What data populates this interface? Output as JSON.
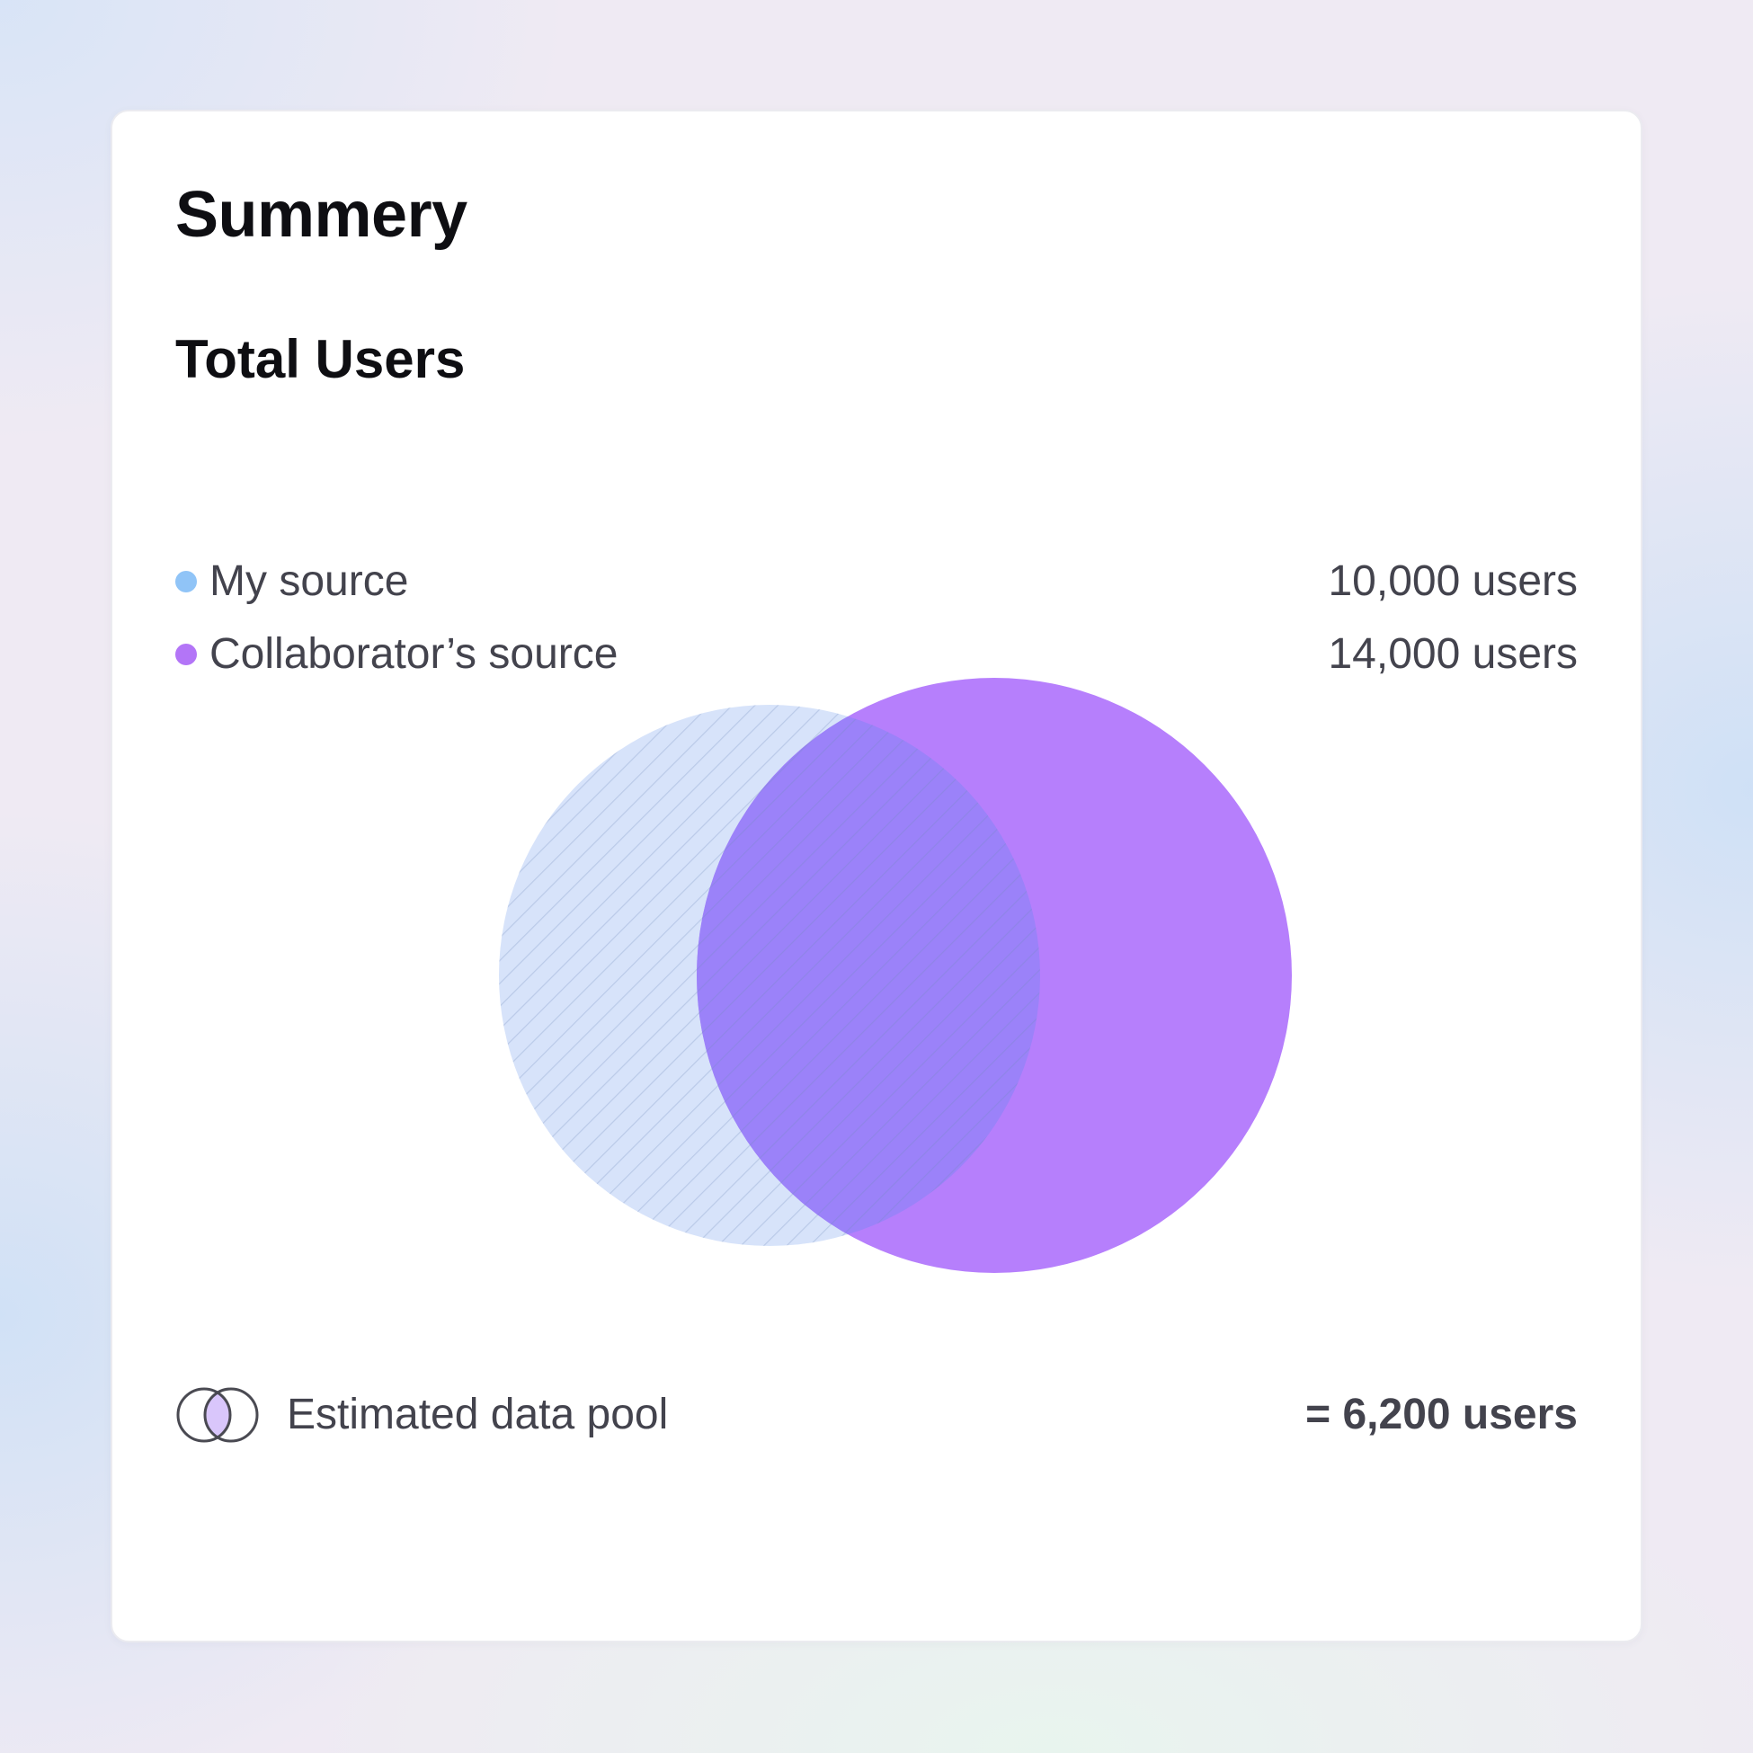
{
  "card": {
    "title": "Summery",
    "subtitle": "Total Users"
  },
  "legend": [
    {
      "label": "My source",
      "value": "10,000 users",
      "color": "#90c4f7"
    },
    {
      "label": "Collaborator’s source",
      "value": "14,000 users",
      "color": "#b375f7"
    }
  ],
  "venn": {
    "sets": [
      {
        "name": "My source",
        "users": 10000,
        "fill": "#d7e3fa",
        "pattern": "diagonal-hatch"
      },
      {
        "name": "Collaborator’s source",
        "users": 14000,
        "fill": "#b67ffc"
      }
    ],
    "overlap_users": 6200,
    "overlap_fill": "#9b82f9"
  },
  "footer": {
    "icon": "venn-overlap-icon",
    "label": "Estimated data pool",
    "value": "= 6,200 users"
  }
}
